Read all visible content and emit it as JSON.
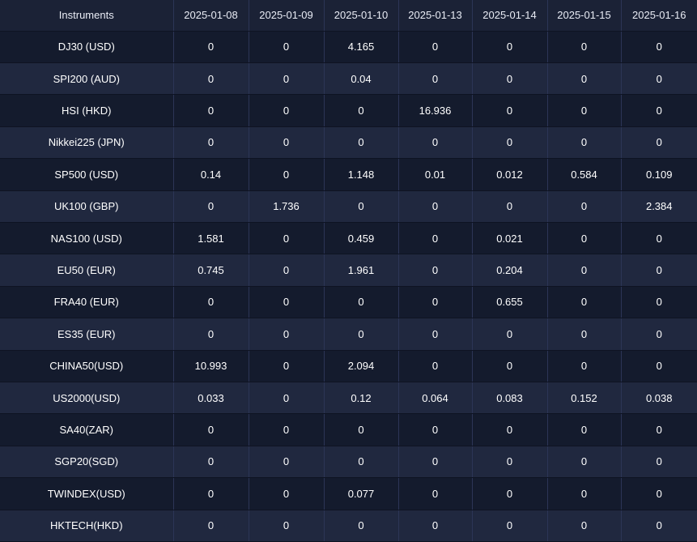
{
  "table": {
    "headers": [
      "Instruments",
      "2025-01-08",
      "2025-01-09",
      "2025-01-10",
      "2025-01-13",
      "2025-01-14",
      "2025-01-15",
      "2025-01-16"
    ],
    "rows": [
      [
        "DJ30 (USD)",
        "0",
        "0",
        "4.165",
        "0",
        "0",
        "0",
        "0"
      ],
      [
        "SPI200 (AUD)",
        "0",
        "0",
        "0.04",
        "0",
        "0",
        "0",
        "0"
      ],
      [
        "HSI (HKD)",
        "0",
        "0",
        "0",
        "16.936",
        "0",
        "0",
        "0"
      ],
      [
        "Nikkei225 (JPN)",
        "0",
        "0",
        "0",
        "0",
        "0",
        "0",
        "0"
      ],
      [
        "SP500 (USD)",
        "0.14",
        "0",
        "1.148",
        "0.01",
        "0.012",
        "0.584",
        "0.109"
      ],
      [
        "UK100 (GBP)",
        "0",
        "1.736",
        "0",
        "0",
        "0",
        "0",
        "2.384"
      ],
      [
        "NAS100 (USD)",
        "1.581",
        "0",
        "0.459",
        "0",
        "0.021",
        "0",
        "0"
      ],
      [
        "EU50 (EUR)",
        "0.745",
        "0",
        "1.961",
        "0",
        "0.204",
        "0",
        "0"
      ],
      [
        "FRA40 (EUR)",
        "0",
        "0",
        "0",
        "0",
        "0.655",
        "0",
        "0"
      ],
      [
        "ES35 (EUR)",
        "0",
        "0",
        "0",
        "0",
        "0",
        "0",
        "0"
      ],
      [
        "CHINA50(USD)",
        "10.993",
        "0",
        "2.094",
        "0",
        "0",
        "0",
        "0"
      ],
      [
        "US2000(USD)",
        "0.033",
        "0",
        "0.12",
        "0.064",
        "0.083",
        "0.152",
        "0.038"
      ],
      [
        "SA40(ZAR)",
        "0",
        "0",
        "0",
        "0",
        "0",
        "0",
        "0"
      ],
      [
        "SGP20(SGD)",
        "0",
        "0",
        "0",
        "0",
        "0",
        "0",
        "0"
      ],
      [
        "TWINDEX(USD)",
        "0",
        "0",
        "0.077",
        "0",
        "0",
        "0",
        "0"
      ],
      [
        "HKTECH(HKD)",
        "0",
        "0",
        "0",
        "0",
        "0",
        "0",
        "0"
      ]
    ]
  }
}
